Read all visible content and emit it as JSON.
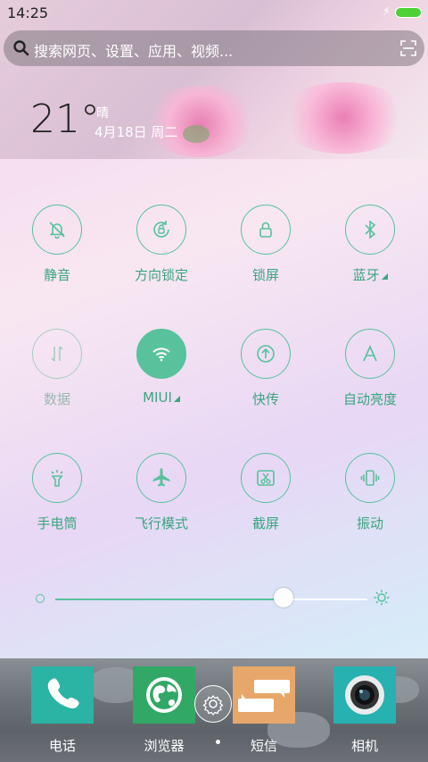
{
  "status_bar": {
    "time": "14:25",
    "charging_icon": "bolt-icon",
    "battery_color": "#4cd137"
  },
  "search": {
    "placeholder": "搜索网页、设置、应用、视频..."
  },
  "weather": {
    "temperature": "21°",
    "condition": "晴",
    "date": "4月18日 周二"
  },
  "toggles": [
    {
      "label": "静音",
      "icon": "bell-off-icon",
      "state": "off"
    },
    {
      "label": "方向锁定",
      "icon": "rotation-lock-icon",
      "state": "off"
    },
    {
      "label": "锁屏",
      "icon": "lock-icon",
      "state": "off"
    },
    {
      "label": "蓝牙",
      "icon": "bluetooth-icon",
      "state": "off"
    },
    {
      "label": "数据",
      "icon": "mobile-data-icon",
      "state": "disabled"
    },
    {
      "label": "MIUI",
      "icon": "wifi-icon",
      "state": "on"
    },
    {
      "label": "快传",
      "icon": "upload-icon",
      "state": "off"
    },
    {
      "label": "自动亮度",
      "icon": "auto-brightness-icon",
      "state": "off"
    },
    {
      "label": "手电筒",
      "icon": "flashlight-icon",
      "state": "off"
    },
    {
      "label": "飞行模式",
      "icon": "airplane-icon",
      "state": "off"
    },
    {
      "label": "截屏",
      "icon": "screenshot-icon",
      "state": "off"
    },
    {
      "label": "振动",
      "icon": "vibrate-icon",
      "state": "off"
    }
  ],
  "brightness": {
    "level": 0.73
  },
  "dock": {
    "apps": [
      {
        "name": "电话",
        "icon": "phone-icon"
      },
      {
        "name": "浏览器",
        "icon": "browser-globe-icon"
      },
      {
        "name": "短信",
        "icon": "messages-icon"
      },
      {
        "name": "相机",
        "icon": "camera-icon"
      }
    ]
  },
  "colors": {
    "accent": "#57c29c",
    "label": "#3aa580"
  }
}
